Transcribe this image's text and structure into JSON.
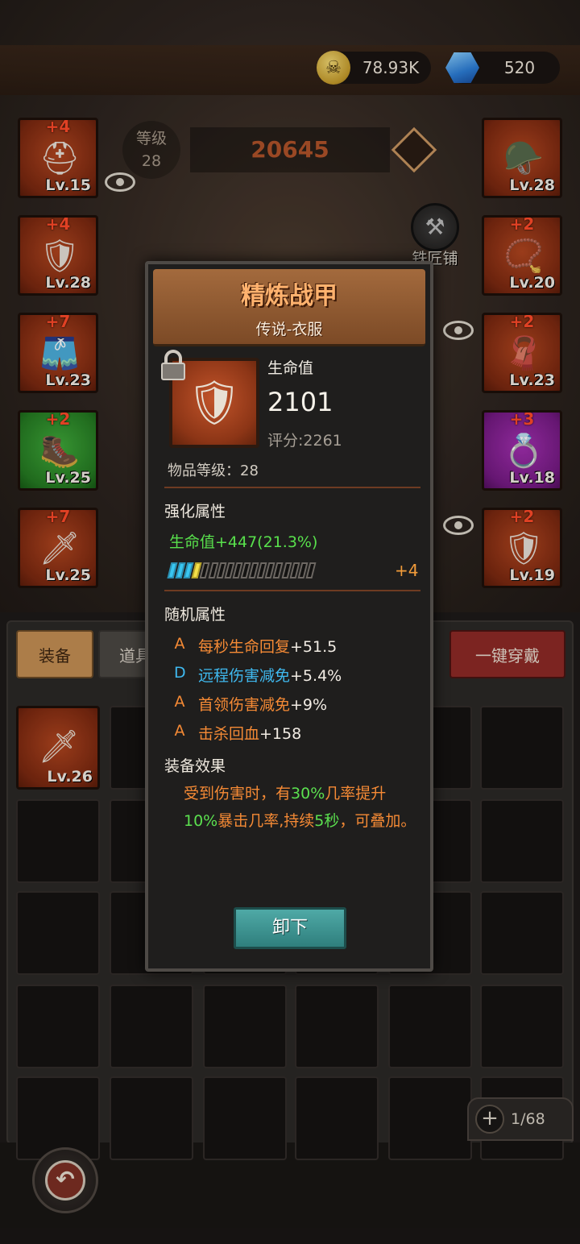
{
  "currency": {
    "gold": "78.93K",
    "gems": "520"
  },
  "hero": {
    "level_label": "等级",
    "level": "28",
    "power": "20645",
    "blacksmith_label": "铁匠铺"
  },
  "slots_left": [
    {
      "plus": "+4",
      "level": "Lv.15",
      "icon": "horned-helmet-icon",
      "glyph": "⛑"
    },
    {
      "plus": "+4",
      "level": "Lv.28",
      "icon": "chest-armor-icon",
      "glyph": "🛡"
    },
    {
      "plus": "+7",
      "level": "Lv.23",
      "icon": "shorts-icon",
      "glyph": "🩳"
    },
    {
      "plus": "+2",
      "level": "Lv.25",
      "icon": "boots-icon",
      "glyph": "🥾"
    },
    {
      "plus": "+7",
      "level": "Lv.25",
      "icon": "dagger-icon",
      "glyph": "🗡"
    }
  ],
  "slots_right": [
    {
      "plus": "",
      "level": "Lv.28",
      "icon": "shoulder-armor-icon",
      "glyph": "🪖"
    },
    {
      "plus": "+2",
      "level": "Lv.20",
      "icon": "amulet-icon",
      "glyph": "📿"
    },
    {
      "plus": "+2",
      "level": "Lv.23",
      "icon": "cape-icon",
      "glyph": "🧣"
    },
    {
      "plus": "+3",
      "level": "Lv.18",
      "icon": "ring-icon",
      "glyph": "💍"
    },
    {
      "plus": "+2",
      "level": "Lv.19",
      "icon": "shield-icon",
      "glyph": "🛡"
    }
  ],
  "tabs": {
    "equip": "装备",
    "items": "道具",
    "wear_all": "一键穿戴"
  },
  "inventory": {
    "first_item_level": "Lv.26",
    "capacity": "1/68"
  },
  "card": {
    "title": "精炼战甲",
    "subtitle": "传说-衣服",
    "stat_name": "生命值",
    "stat_value": "2101",
    "score": "评分:2261",
    "item_level": "物品等级：28",
    "enhance_title": "强化属性",
    "enhance_line": "生命值+447(21.3%)",
    "enhance_level": "+4",
    "enhance_progress": 0.2,
    "random_title": "随机属性",
    "random_attrs": [
      {
        "grade": "A",
        "name": "每秒生命回复",
        "value": "+51.5"
      },
      {
        "grade": "D",
        "name": "远程伤害减免",
        "value": "+5.4%"
      },
      {
        "grade": "A",
        "name": "首领伤害减免",
        "value": "+9%"
      },
      {
        "grade": "A",
        "name": "击杀回血",
        "value": "+158"
      }
    ],
    "effect_title": "装备效果",
    "effect_parts": [
      "受到伤害时，有",
      "30%",
      "几率提升",
      "10%",
      "暴击几率,持续",
      "5秒",
      "，可叠加。"
    ],
    "unequip": "卸下"
  },
  "colors": {
    "accent_orange": "#f58a35",
    "accent_green": "#5be04f",
    "accent_blue": "#3fb9ef",
    "title_orange": "#ffb26e"
  }
}
